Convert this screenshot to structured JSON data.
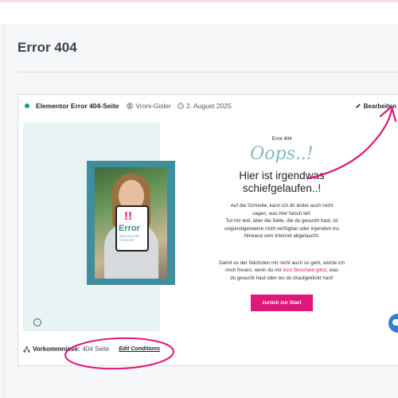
{
  "page": {
    "title": "Error 404"
  },
  "card": {
    "status_color": "#1a9e6b",
    "title": "Elementor Error 404-Seite",
    "author": "Vroni-Gisler",
    "date": "2. August 2025",
    "edit_label": "Bearbeiten",
    "footer": {
      "label": "Vorkommnisse:",
      "value": "404 Seite",
      "link": "Edit Conditions"
    }
  },
  "preview": {
    "small_heading": "Error 404",
    "oops": "Oops..!",
    "headline_line1": "Hier ist irgendwas",
    "headline_line2": "schiefgelaufen..!",
    "para1_line1": "Auf die Schnelle, kann ich dir leider auch nicht",
    "para1_line2": "sagen, was hier falsch lief.",
    "para1_line3": "Tut mir leid, aber die Seite, die du gesucht hast, ist",
    "para1_line4": "ungünstigerweise nicht verfügbar oder irgendwo ins",
    "para1_line5": "Nirwana vom Internet abgetaucht.",
    "para2_line1": "Damit es der Nächsten mir nicht auch so geht, würde ich",
    "para2_line2_pre": "mich freuen, wenn du mir ",
    "para2_link": "kurz Bescheid gibst",
    "para2_line2_post": ", was",
    "para2_line3": "du gesucht hast oder wo du draufgeklickt hast!",
    "cta_label": "zurück zur Start",
    "image": {
      "mark": "!!",
      "text": "Error",
      "subtext": "MAGISCHE FEHLER"
    }
  },
  "colors": {
    "accent_pink": "#e0177a",
    "mint_panel": "#e8f4f4",
    "frame_teal": "#3e8ea0"
  },
  "icons": {
    "user": "user-icon",
    "clock": "clock-icon",
    "edit": "pencil-icon",
    "conditions": "sitemap-icon",
    "chat": "chat-icon"
  }
}
